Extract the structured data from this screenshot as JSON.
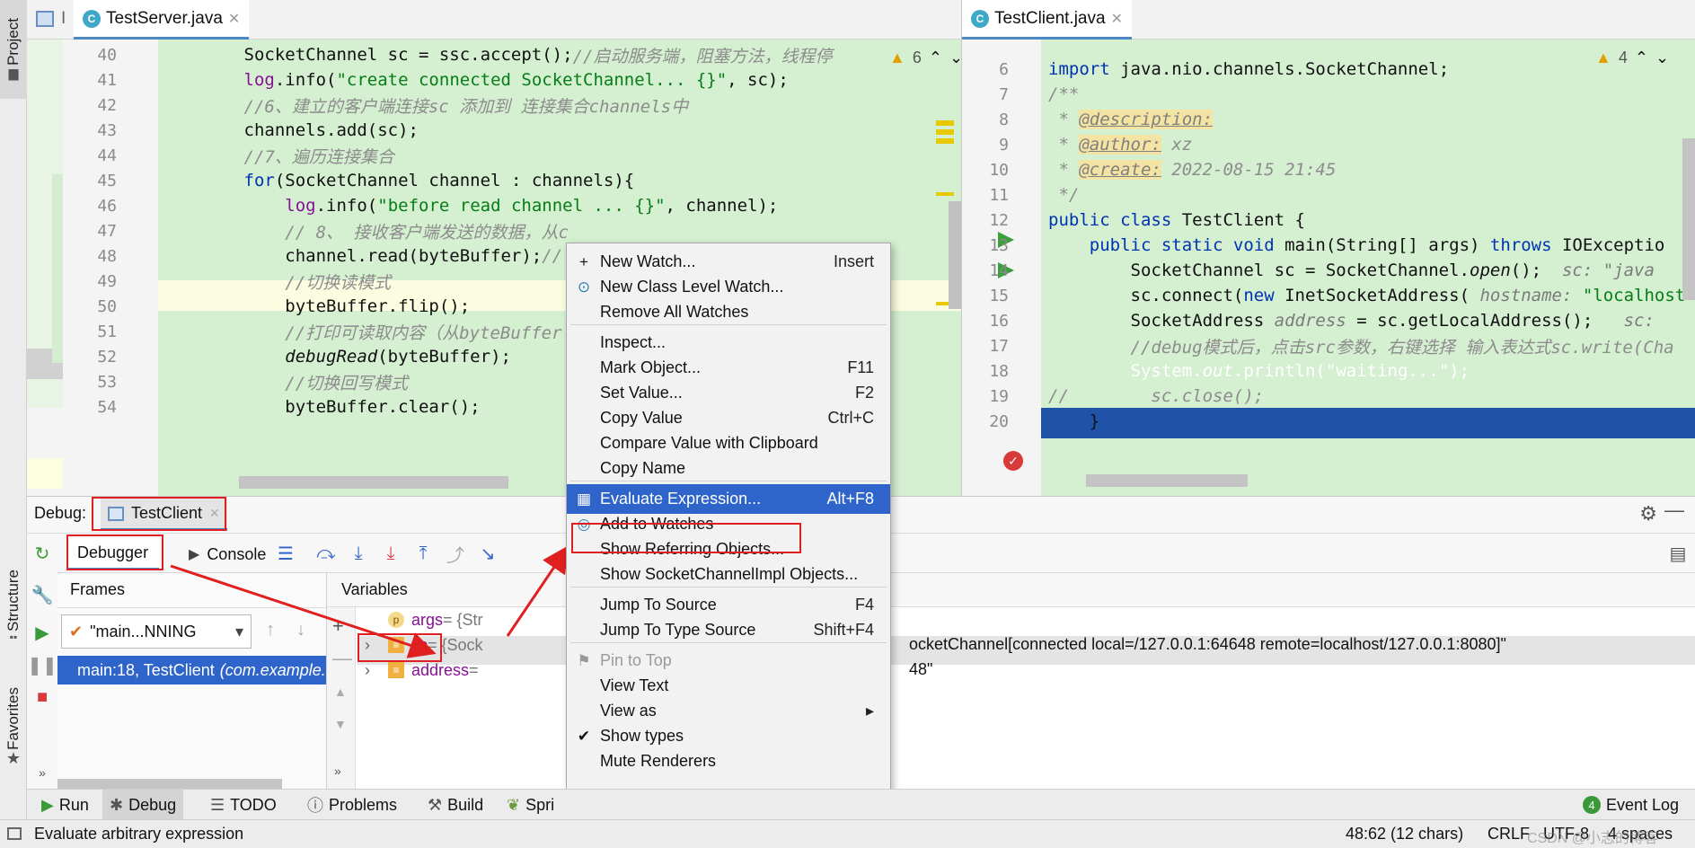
{
  "sidebar": {
    "project_label": "Project",
    "structure_label": "Structure",
    "favorites_label": "Favorites"
  },
  "left_editor": {
    "tab_title": "TestServer.java",
    "inspection_count": "6",
    "lines": [
      {
        "n": "40",
        "parts": [
          [
            "",
            "        SocketChannel sc = ssc.accept();"
          ],
          [
            "cm",
            "//启动服务端，阻塞方法，线程停"
          ]
        ]
      },
      {
        "n": "41",
        "parts": [
          [
            "",
            "        "
          ],
          [
            "fld",
            "log"
          ],
          [
            "",
            ".info("
          ],
          [
            "str",
            "\"create connected SocketChannel... {}\""
          ],
          [
            "",
            ", sc);"
          ]
        ]
      },
      {
        "n": "42",
        "parts": [
          [
            "cm",
            "        //6、建立的客户端连接sc 添加到 连接集合channels中"
          ]
        ]
      },
      {
        "n": "43",
        "parts": [
          [
            "",
            "        channels.add(sc);"
          ]
        ]
      },
      {
        "n": "44",
        "parts": [
          [
            "cm",
            "        //7、遍历连接集合"
          ]
        ]
      },
      {
        "n": "45",
        "parts": [
          [
            "",
            "        "
          ],
          [
            "kw",
            "for"
          ],
          [
            "",
            "(SocketChannel channel : channels){"
          ]
        ]
      },
      {
        "n": "46",
        "parts": [
          [
            "",
            "            "
          ],
          [
            "fld",
            "log"
          ],
          [
            "",
            ".info("
          ],
          [
            "str",
            "\"before read channel ... {}\""
          ],
          [
            "",
            ", channel);"
          ]
        ]
      },
      {
        "n": "47",
        "parts": [
          [
            "cm",
            "            // 8、 接收客户端发送的数据，从c"
          ]
        ]
      },
      {
        "n": "48",
        "parts": [
          [
            "",
            "            channel.read(byteBuffer);"
          ],
          [
            "cm",
            "//"
          ]
        ]
      },
      {
        "n": "49",
        "parts": [
          [
            "cm",
            "            //切换读模式"
          ]
        ]
      },
      {
        "n": "50",
        "parts": [
          [
            "",
            "            byteBuffer.flip();"
          ]
        ]
      },
      {
        "n": "51",
        "parts": [
          [
            "cm",
            "            //打印可读取内容（从byteBuffer"
          ]
        ]
      },
      {
        "n": "52",
        "parts": [
          [
            "",
            "            "
          ],
          [
            "it",
            "debugRead"
          ],
          [
            "",
            "(byteBuffer);"
          ]
        ]
      },
      {
        "n": "53",
        "parts": [
          [
            "cm",
            "            //切换回写模式"
          ]
        ]
      },
      {
        "n": "54",
        "parts": [
          [
            "",
            "            byteBuffer.clear();"
          ]
        ]
      }
    ]
  },
  "right_editor": {
    "tab_title": "TestClient.java",
    "inspection_count": "4",
    "lines": [
      {
        "n": "6",
        "parts": [
          [
            "kw",
            "import"
          ],
          [
            "",
            " java.nio.channels.SocketChannel;"
          ]
        ]
      },
      {
        "n": "7",
        "parts": [
          [
            "cm",
            "/**"
          ]
        ]
      },
      {
        "n": "8",
        "parts": [
          [
            "cm",
            " * "
          ],
          [
            "tag",
            "@description:"
          ]
        ]
      },
      {
        "n": "9",
        "parts": [
          [
            "cm",
            " * "
          ],
          [
            "tag",
            "@author:"
          ],
          [
            "cm",
            " xz"
          ]
        ]
      },
      {
        "n": "10",
        "parts": [
          [
            "cm",
            " * "
          ],
          [
            "tag",
            "@create:"
          ],
          [
            "cm",
            " 2022-08-15 21:45"
          ]
        ]
      },
      {
        "n": "11",
        "parts": [
          [
            "cm",
            " */"
          ]
        ]
      },
      {
        "n": "12",
        "parts": [
          [
            "kw",
            "public class"
          ],
          [
            "",
            " TestClient {"
          ]
        ]
      },
      {
        "n": "13",
        "parts": [
          [
            "",
            "    "
          ],
          [
            "kw",
            "public static void"
          ],
          [
            "",
            " main(String[] args) "
          ],
          [
            "kw",
            "throws"
          ],
          [
            "",
            " IOExceptio"
          ]
        ]
      },
      {
        "n": "14",
        "parts": [
          [
            "",
            "        SocketChannel sc = SocketChannel."
          ],
          [
            "it",
            "open"
          ],
          [
            "",
            "();  "
          ],
          [
            "hint",
            "sc: \"java"
          ]
        ]
      },
      {
        "n": "15",
        "parts": [
          [
            "",
            "        sc.connect("
          ],
          [
            "kw",
            "new"
          ],
          [
            "",
            " InetSocketAddress( "
          ],
          [
            "hint",
            "hostname:"
          ],
          [
            "str",
            " \"localhost"
          ]
        ]
      },
      {
        "n": "16",
        "parts": [
          [
            "",
            "        SocketAddress "
          ],
          [
            "hint",
            "address"
          ],
          [
            "",
            " = sc.getLocalAddress();   "
          ],
          [
            "hint",
            "sc:"
          ]
        ]
      },
      {
        "n": "17",
        "parts": [
          [
            "cm",
            "        //debug模式后，点击src参数，右键选择 输入表达式sc.write(Cha"
          ]
        ]
      },
      {
        "n": "18",
        "parts": [
          [
            "",
            "        System."
          ],
          [
            "it",
            "out"
          ],
          [
            "",
            ".println("
          ],
          [
            "str",
            "\"waiting...\""
          ],
          [
            "",
            ");"
          ]
        ]
      },
      {
        "n": "19",
        "parts": [
          [
            "cm",
            "//        sc.close();"
          ]
        ]
      },
      {
        "n": "20",
        "parts": [
          [
            "",
            "    }"
          ]
        ]
      }
    ]
  },
  "debug": {
    "label": "Debug:",
    "session_tab": "TestClient",
    "debugger_tab": "Debugger",
    "console_tab": "Console",
    "frames_title": "Frames",
    "variables_title": "Variables",
    "thread_select": "\"main...NNING",
    "frame_row_main": "main:18, TestClient",
    "frame_row_pkg": "(com.example.netty",
    "variables": [
      {
        "icon": "p",
        "name": "args",
        "value": " = {Str"
      },
      {
        "icon": "field",
        "name": "sc",
        "value": " = {Sock",
        "detail": "ocketChannel[connected local=/127.0.0.1:64648 remote=localhost/127.0.0.1:8080]\""
      },
      {
        "icon": "field",
        "name": "address",
        "value": " = ",
        "detail": "48\""
      }
    ]
  },
  "context_menu": {
    "items": [
      {
        "label": "New Watch...",
        "shortcut": "Insert",
        "icon": "+"
      },
      {
        "label": "New Class Level Watch...",
        "shortcut": "",
        "icon": "class-watch"
      },
      {
        "label": "Remove All Watches",
        "shortcut": ""
      },
      {
        "sep": true
      },
      {
        "label": "Inspect...",
        "shortcut": ""
      },
      {
        "label": "Mark Object...",
        "shortcut": "F11"
      },
      {
        "label": "Set Value...",
        "shortcut": "F2"
      },
      {
        "label": "Copy Value",
        "shortcut": "Ctrl+C"
      },
      {
        "label": "Compare Value with Clipboard",
        "shortcut": ""
      },
      {
        "label": "Copy Name",
        "shortcut": ""
      },
      {
        "sep": true
      },
      {
        "label": "Evaluate Expression...",
        "shortcut": "Alt+F8",
        "icon": "calc",
        "selected": true
      },
      {
        "label": "Add to Watches",
        "shortcut": "",
        "icon": "watches"
      },
      {
        "label": "Show Referring Objects...",
        "shortcut": ""
      },
      {
        "label": "Show SocketChannelImpl Objects...",
        "shortcut": ""
      },
      {
        "sep": true
      },
      {
        "label": "Jump To Source",
        "shortcut": "F4"
      },
      {
        "label": "Jump To Type Source",
        "shortcut": "Shift+F4"
      },
      {
        "sep": true
      },
      {
        "label": "Pin to Top",
        "shortcut": "",
        "icon": "pin",
        "disabled": true
      },
      {
        "label": "View Text",
        "shortcut": ""
      },
      {
        "label": "View as",
        "shortcut": "▸"
      },
      {
        "label": "Show types",
        "shortcut": "",
        "icon": "check"
      },
      {
        "label": "Mute Renderers",
        "shortcut": ""
      }
    ]
  },
  "toolwindows": {
    "run": "Run",
    "debug": "Debug",
    "todo": "TODO",
    "problems": "Problems",
    "build": "Build",
    "spring": "Spri",
    "event_log_count": "4",
    "event_log": "Event Log"
  },
  "statusbar": {
    "message": "Evaluate arbitrary expression",
    "position": "48:62 (12 chars)",
    "line_sep": "CRLF",
    "encoding": "UTF-8",
    "indent": "4 spaces",
    "watermark": "CSDN @小志的博客"
  },
  "colors": {
    "accent_blue": "#2f65ca",
    "annotation_red": "#e02020",
    "code_bg_green": "#d5efd1",
    "current_line_blue": "#2052a8"
  }
}
